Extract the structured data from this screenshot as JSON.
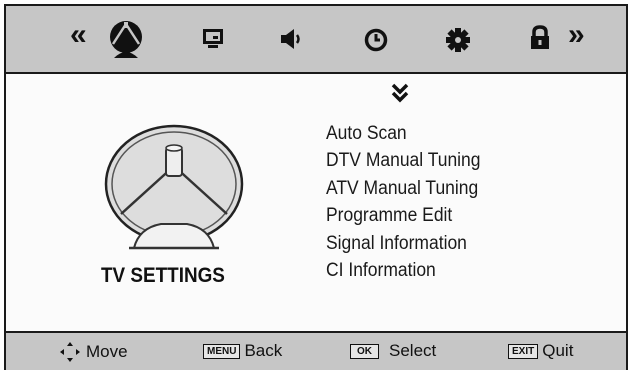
{
  "menu": {
    "items": [
      {
        "label": "Auto Scan"
      },
      {
        "label": "DTV Manual Tuning"
      },
      {
        "label": "ATV Manual Tuning"
      },
      {
        "label": "Programme Edit"
      },
      {
        "label": "Signal Information"
      },
      {
        "label": "CI Information"
      }
    ]
  },
  "section_title": "TV SETTINGS",
  "top_nav": {
    "prev_glyph": "«",
    "next_glyph": "»",
    "tabs": [
      {
        "icon": "satellite-dish-icon",
        "selected": true
      },
      {
        "icon": "picture-icon"
      },
      {
        "icon": "speaker-icon"
      },
      {
        "icon": "clock-icon"
      },
      {
        "icon": "gear-icon"
      },
      {
        "icon": "lock-icon"
      }
    ]
  },
  "hints": {
    "move": {
      "label": "Move"
    },
    "back": {
      "key": "MENU",
      "label": "Back"
    },
    "select": {
      "key": "OK",
      "label": "Select"
    },
    "quit": {
      "key": "EXIT",
      "label": "Quit"
    }
  },
  "colors": {
    "bar_bg": "#c6c6c6",
    "panel_bg": "#fbfbfb",
    "ink": "#111111"
  }
}
